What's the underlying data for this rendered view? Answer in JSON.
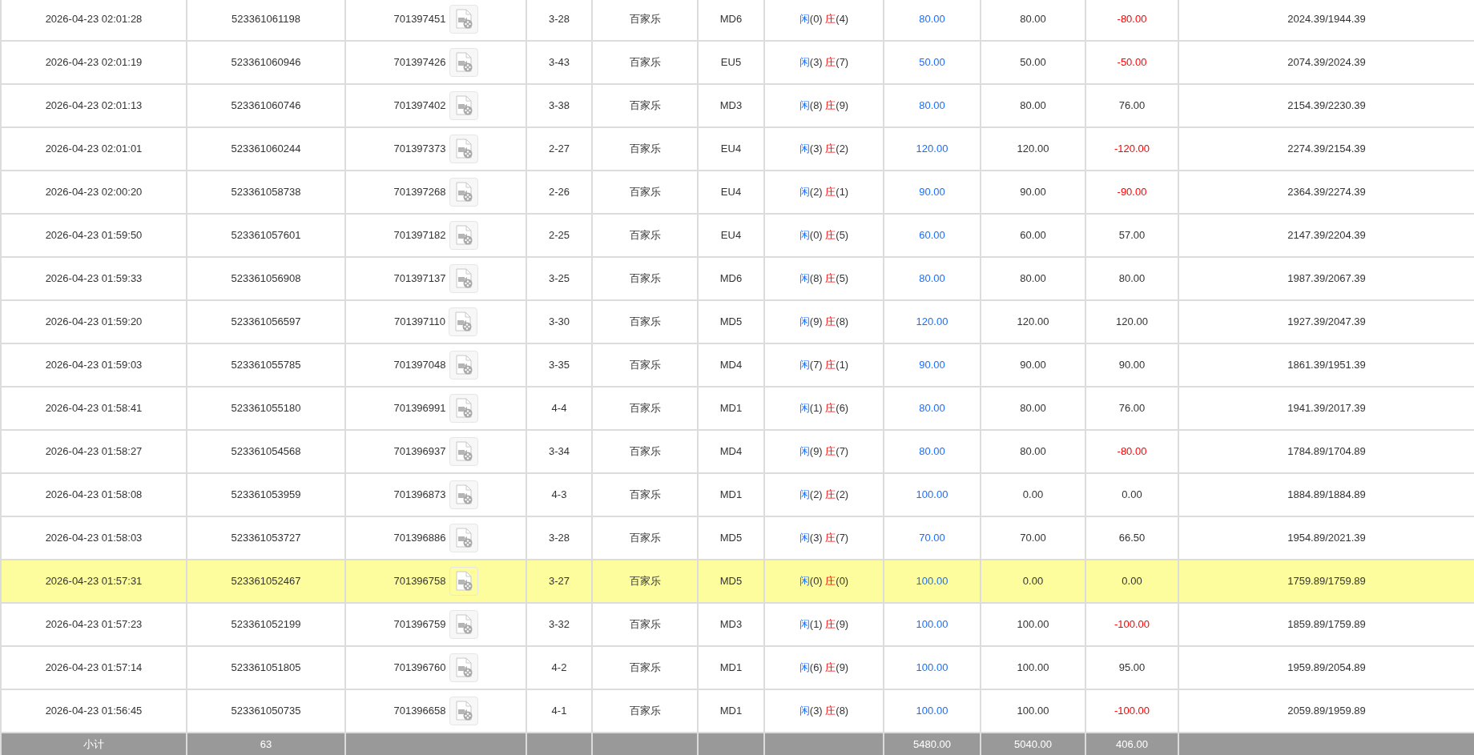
{
  "rows": [
    {
      "time": "2026-04-23 02:01:28",
      "bet_id": "523361061198",
      "game_id": "701397451",
      "shoe": "3-28",
      "game": "百家乐",
      "table": "MD6",
      "player_label": "闲",
      "player_score": "(0)",
      "banker_label": "庄",
      "banker_score": "(4)",
      "bet": "80.00",
      "valid_bet": "80.00",
      "win_loss": "-80.00",
      "loss": true,
      "balance": "2024.39/1944.39",
      "selected": false
    },
    {
      "time": "2026-04-23 02:01:19",
      "bet_id": "523361060946",
      "game_id": "701397426",
      "shoe": "3-43",
      "game": "百家乐",
      "table": "EU5",
      "player_label": "闲",
      "player_score": "(3)",
      "banker_label": "庄",
      "banker_score": "(7)",
      "bet": "50.00",
      "valid_bet": "50.00",
      "win_loss": "-50.00",
      "loss": true,
      "balance": "2074.39/2024.39",
      "selected": false
    },
    {
      "time": "2026-04-23 02:01:13",
      "bet_id": "523361060746",
      "game_id": "701397402",
      "shoe": "3-38",
      "game": "百家乐",
      "table": "MD3",
      "player_label": "闲",
      "player_score": "(8)",
      "banker_label": "庄",
      "banker_score": "(9)",
      "bet": "80.00",
      "valid_bet": "80.00",
      "win_loss": "76.00",
      "loss": false,
      "balance": "2154.39/2230.39",
      "selected": false
    },
    {
      "time": "2026-04-23 02:01:01",
      "bet_id": "523361060244",
      "game_id": "701397373",
      "shoe": "2-27",
      "game": "百家乐",
      "table": "EU4",
      "player_label": "闲",
      "player_score": "(3)",
      "banker_label": "庄",
      "banker_score": "(2)",
      "bet": "120.00",
      "valid_bet": "120.00",
      "win_loss": "-120.00",
      "loss": true,
      "balance": "2274.39/2154.39",
      "selected": false
    },
    {
      "time": "2026-04-23 02:00:20",
      "bet_id": "523361058738",
      "game_id": "701397268",
      "shoe": "2-26",
      "game": "百家乐",
      "table": "EU4",
      "player_label": "闲",
      "player_score": "(2)",
      "banker_label": "庄",
      "banker_score": "(1)",
      "bet": "90.00",
      "valid_bet": "90.00",
      "win_loss": "-90.00",
      "loss": true,
      "balance": "2364.39/2274.39",
      "selected": false
    },
    {
      "time": "2026-04-23 01:59:50",
      "bet_id": "523361057601",
      "game_id": "701397182",
      "shoe": "2-25",
      "game": "百家乐",
      "table": "EU4",
      "player_label": "闲",
      "player_score": "(0)",
      "banker_label": "庄",
      "banker_score": "(5)",
      "bet": "60.00",
      "valid_bet": "60.00",
      "win_loss": "57.00",
      "loss": false,
      "balance": "2147.39/2204.39",
      "selected": false
    },
    {
      "time": "2026-04-23 01:59:33",
      "bet_id": "523361056908",
      "game_id": "701397137",
      "shoe": "3-25",
      "game": "百家乐",
      "table": "MD6",
      "player_label": "闲",
      "player_score": "(8)",
      "banker_label": "庄",
      "banker_score": "(5)",
      "bet": "80.00",
      "valid_bet": "80.00",
      "win_loss": "80.00",
      "loss": false,
      "balance": "1987.39/2067.39",
      "selected": false
    },
    {
      "time": "2026-04-23 01:59:20",
      "bet_id": "523361056597",
      "game_id": "701397110",
      "shoe": "3-30",
      "game": "百家乐",
      "table": "MD5",
      "player_label": "闲",
      "player_score": "(9)",
      "banker_label": "庄",
      "banker_score": "(8)",
      "bet": "120.00",
      "valid_bet": "120.00",
      "win_loss": "120.00",
      "loss": false,
      "balance": "1927.39/2047.39",
      "selected": false
    },
    {
      "time": "2026-04-23 01:59:03",
      "bet_id": "523361055785",
      "game_id": "701397048",
      "shoe": "3-35",
      "game": "百家乐",
      "table": "MD4",
      "player_label": "闲",
      "player_score": "(7)",
      "banker_label": "庄",
      "banker_score": "(1)",
      "bet": "90.00",
      "valid_bet": "90.00",
      "win_loss": "90.00",
      "loss": false,
      "balance": "1861.39/1951.39",
      "selected": false
    },
    {
      "time": "2026-04-23 01:58:41",
      "bet_id": "523361055180",
      "game_id": "701396991",
      "shoe": "4-4",
      "game": "百家乐",
      "table": "MD1",
      "player_label": "闲",
      "player_score": "(1)",
      "banker_label": "庄",
      "banker_score": "(6)",
      "bet": "80.00",
      "valid_bet": "80.00",
      "win_loss": "76.00",
      "loss": false,
      "balance": "1941.39/2017.39",
      "selected": false
    },
    {
      "time": "2026-04-23 01:58:27",
      "bet_id": "523361054568",
      "game_id": "701396937",
      "shoe": "3-34",
      "game": "百家乐",
      "table": "MD4",
      "player_label": "闲",
      "player_score": "(9)",
      "banker_label": "庄",
      "banker_score": "(7)",
      "bet": "80.00",
      "valid_bet": "80.00",
      "win_loss": "-80.00",
      "loss": true,
      "balance": "1784.89/1704.89",
      "selected": false
    },
    {
      "time": "2026-04-23 01:58:08",
      "bet_id": "523361053959",
      "game_id": "701396873",
      "shoe": "4-3",
      "game": "百家乐",
      "table": "MD1",
      "player_label": "闲",
      "player_score": "(2)",
      "banker_label": "庄",
      "banker_score": "(2)",
      "bet": "100.00",
      "valid_bet": "0.00",
      "win_loss": "0.00",
      "loss": false,
      "balance": "1884.89/1884.89",
      "selected": false
    },
    {
      "time": "2026-04-23 01:58:03",
      "bet_id": "523361053727",
      "game_id": "701396886",
      "shoe": "3-28",
      "game": "百家乐",
      "table": "MD5",
      "player_label": "闲",
      "player_score": "(3)",
      "banker_label": "庄",
      "banker_score": "(7)",
      "bet": "70.00",
      "valid_bet": "70.00",
      "win_loss": "66.50",
      "loss": false,
      "balance": "1954.89/2021.39",
      "selected": false
    },
    {
      "time": "2026-04-23 01:57:31",
      "bet_id": "523361052467",
      "game_id": "701396758",
      "shoe": "3-27",
      "game": "百家乐",
      "table": "MD5",
      "player_label": "闲",
      "player_score": "(0)",
      "banker_label": "庄",
      "banker_score": "(0)",
      "bet": "100.00",
      "valid_bet": "0.00",
      "win_loss": "0.00",
      "loss": false,
      "balance": "1759.89/1759.89",
      "selected": true
    },
    {
      "time": "2026-04-23 01:57:23",
      "bet_id": "523361052199",
      "game_id": "701396759",
      "shoe": "3-32",
      "game": "百家乐",
      "table": "MD3",
      "player_label": "闲",
      "player_score": "(1)",
      "banker_label": "庄",
      "banker_score": "(9)",
      "bet": "100.00",
      "valid_bet": "100.00",
      "win_loss": "-100.00",
      "loss": true,
      "balance": "1859.89/1759.89",
      "selected": false
    },
    {
      "time": "2026-04-23 01:57:14",
      "bet_id": "523361051805",
      "game_id": "701396760",
      "shoe": "4-2",
      "game": "百家乐",
      "table": "MD1",
      "player_label": "闲",
      "player_score": "(6)",
      "banker_label": "庄",
      "banker_score": "(9)",
      "bet": "100.00",
      "valid_bet": "100.00",
      "win_loss": "95.00",
      "loss": false,
      "balance": "1959.89/2054.89",
      "selected": false
    },
    {
      "time": "2026-04-23 01:56:45",
      "bet_id": "523361050735",
      "game_id": "701396658",
      "shoe": "4-1",
      "game": "百家乐",
      "table": "MD1",
      "player_label": "闲",
      "player_score": "(3)",
      "banker_label": "庄",
      "banker_score": "(8)",
      "bet": "100.00",
      "valid_bet": "100.00",
      "win_loss": "-100.00",
      "loss": true,
      "balance": "2059.89/1959.89",
      "selected": false
    }
  ],
  "subtotal": {
    "label": "小计",
    "count": "63",
    "bet": "5480.00",
    "valid_bet": "5040.00",
    "win_loss": "406.00"
  }
}
